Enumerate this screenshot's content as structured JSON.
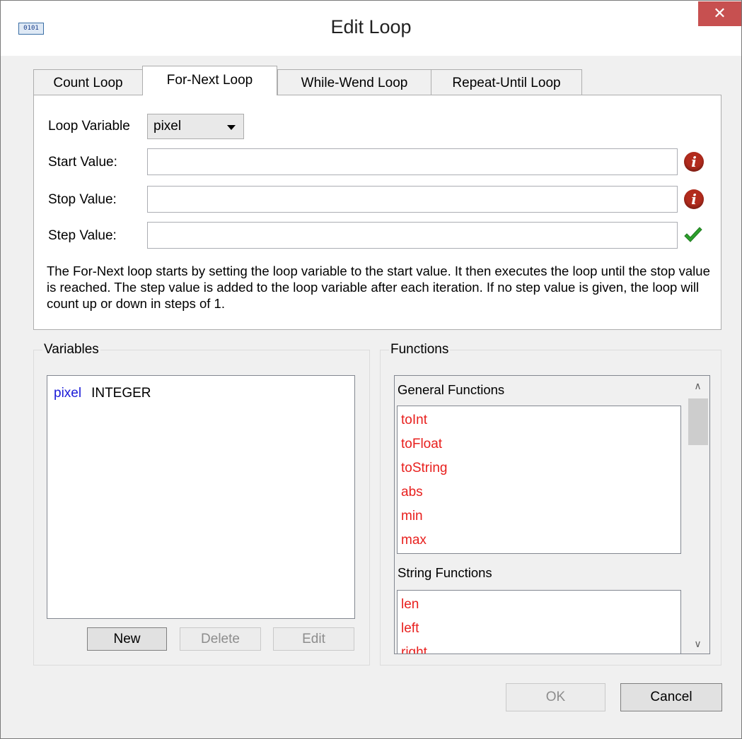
{
  "window": {
    "title": "Edit Loop",
    "app_icon_text": "0101",
    "close_glyph": "✕"
  },
  "tabs": [
    {
      "label": "Count Loop",
      "active": false
    },
    {
      "label": "For-Next Loop",
      "active": true
    },
    {
      "label": "While-Wend Loop",
      "active": false
    },
    {
      "label": "Repeat-Until Loop",
      "active": false
    }
  ],
  "form": {
    "loop_variable_label": "Loop Variable",
    "loop_variable_value": "pixel",
    "start_label": "Start Value:",
    "start_value": "",
    "start_status": "error",
    "stop_label": "Stop Value:",
    "stop_value": "",
    "stop_status": "error",
    "step_label": "Step Value:",
    "step_value": "",
    "step_status": "ok",
    "info_glyph": "i",
    "description": "The For-Next loop starts by setting the loop variable to the start value. It then executes the loop until the stop value is reached. The step value is added to the loop variable after each iteration. If no step value is given, the loop will count up or down in steps of 1."
  },
  "variables": {
    "title": "Variables",
    "items": [
      {
        "name": "pixel",
        "type": "INTEGER"
      }
    ],
    "buttons": {
      "new": "New",
      "delete": "Delete",
      "edit": "Edit"
    }
  },
  "functions": {
    "title": "Functions",
    "categories": [
      {
        "title": "General Functions",
        "items": [
          "toInt",
          "toFloat",
          "toString",
          "abs",
          "min",
          "max"
        ]
      },
      {
        "title": "String Functions",
        "items": [
          "len",
          "left",
          "right"
        ]
      }
    ],
    "scroll_up_glyph": "∧",
    "scroll_down_glyph": "∨"
  },
  "footer": {
    "ok": "OK",
    "cancel": "Cancel"
  },
  "colors": {
    "variable_name": "#1b1bd8",
    "function_name": "#e8201e",
    "error_icon": "#b22b1d",
    "ok_icon": "#2ca02c",
    "close_button": "#c75050"
  }
}
